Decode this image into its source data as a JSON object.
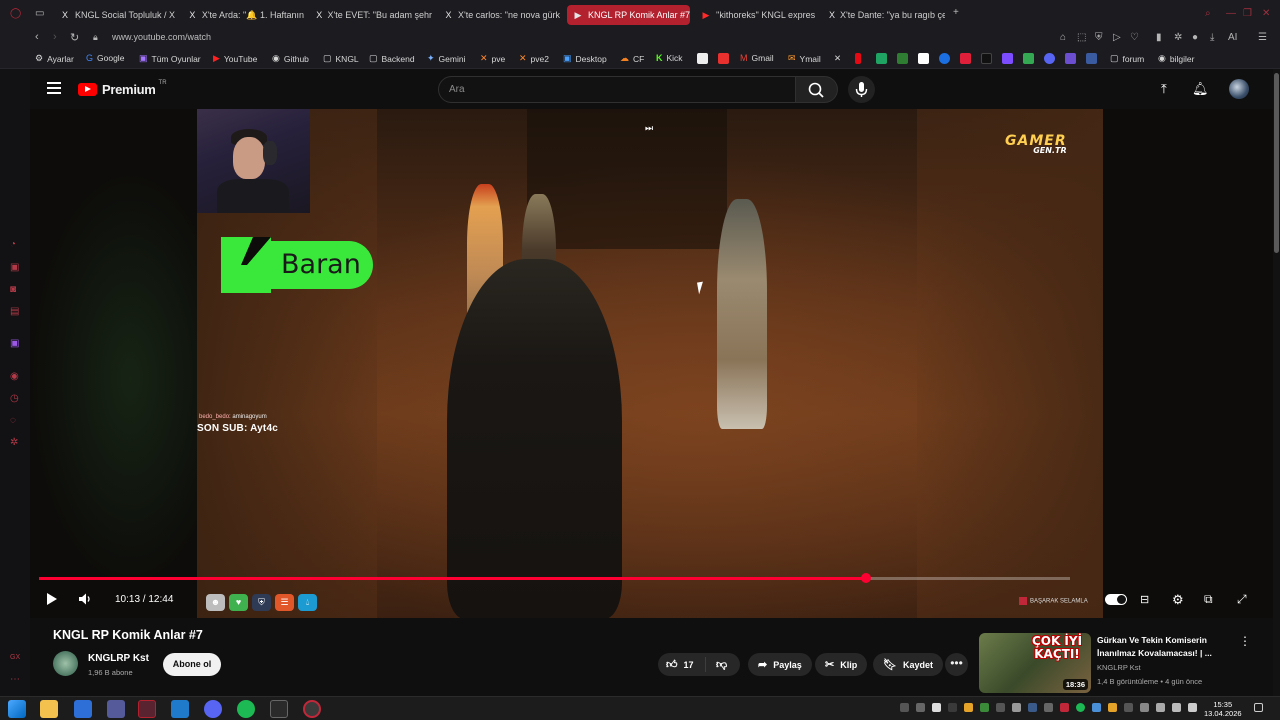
{
  "browser": {
    "tabs": [
      {
        "icon": "X",
        "label": "KNGL Social Topluluk / X"
      },
      {
        "icon": "X",
        "label": "X'te Arda: \"🔔 1. Haftanın"
      },
      {
        "icon": "X",
        "label": "X'te EVET: \"Bu adam şehr"
      },
      {
        "icon": "X",
        "label": "X'te carlos: \"ne nova gürk"
      },
      {
        "icon": "▶",
        "label": "KNGL RP Komik Anlar #7"
      },
      {
        "icon": "▶",
        "label": "''kithoreks'' KNGL expres"
      },
      {
        "icon": "X",
        "label": "X'te Dante: \"ya bu ragıb çe"
      }
    ],
    "new_tab": "+",
    "url": "www.youtube.com/watch",
    "bookmarks": [
      {
        "icon": "⚙",
        "label": "Ayarlar"
      },
      {
        "icon": "G",
        "label": "Google"
      },
      {
        "icon": "▣",
        "label": "Tüm Oyunlar"
      },
      {
        "icon": "▶",
        "label": "YouTube"
      },
      {
        "icon": "◉",
        "label": "Github"
      },
      {
        "icon": "▢",
        "label": "KNGL"
      },
      {
        "icon": "▢",
        "label": "Backend"
      },
      {
        "icon": "✦",
        "label": "Gemini"
      },
      {
        "icon": "✕",
        "label": "pve"
      },
      {
        "icon": "✕",
        "label": "pve2"
      },
      {
        "icon": "▣",
        "label": "Desktop"
      },
      {
        "icon": "☁",
        "label": "CF"
      },
      {
        "icon": "K",
        "label": "Kick"
      },
      {
        "icon": "M",
        "label": "Gmail"
      },
      {
        "icon": "✉",
        "label": "Ymail"
      },
      {
        "icon": "▢",
        "label": "forum"
      },
      {
        "icon": "◉",
        "label": "bilgiler"
      }
    ],
    "toolbar_ai": "AI"
  },
  "youtube": {
    "logo_text": "Premium",
    "logo_region": "TR",
    "search_placeholder": "Ara"
  },
  "video": {
    "overlay_name": "Baran",
    "chat_user": "bedo_bedo",
    "chat_message": ": aminagoyum",
    "last_sub": "SON SUB: Ayt4c",
    "watermark_top": "GAMER",
    "watermark_bottom": "GEN.TR",
    "current_time": "10:13",
    "duration": "12:44",
    "time_sep": " / ",
    "progress_fraction": 0.8024,
    "greeting_badge": "BAŞARAK SELAMLA"
  },
  "details": {
    "title": "KNGL RP Komik Anlar #7",
    "channel": "KNGLRP Kst",
    "subscribers": "1,96 B abone",
    "subscribe_label": "Abone ol",
    "like_count": "17",
    "share_label": "Paylaş",
    "clip_label": "Klip",
    "save_label": "Kaydet",
    "more_label": "•••"
  },
  "recommendation": {
    "thumb_text": "ÇOK İYİ KAÇTI!",
    "duration": "18:36",
    "title": "Gürkan Ve Tekin Komiserin İnanılmaz Kovalamacası! | ...",
    "channel": "KNGLRP Kst",
    "meta": "1,4 B görüntüleme • 4 gün önce"
  },
  "taskbar": {
    "time": "15:35",
    "date": "13.04.2026"
  }
}
